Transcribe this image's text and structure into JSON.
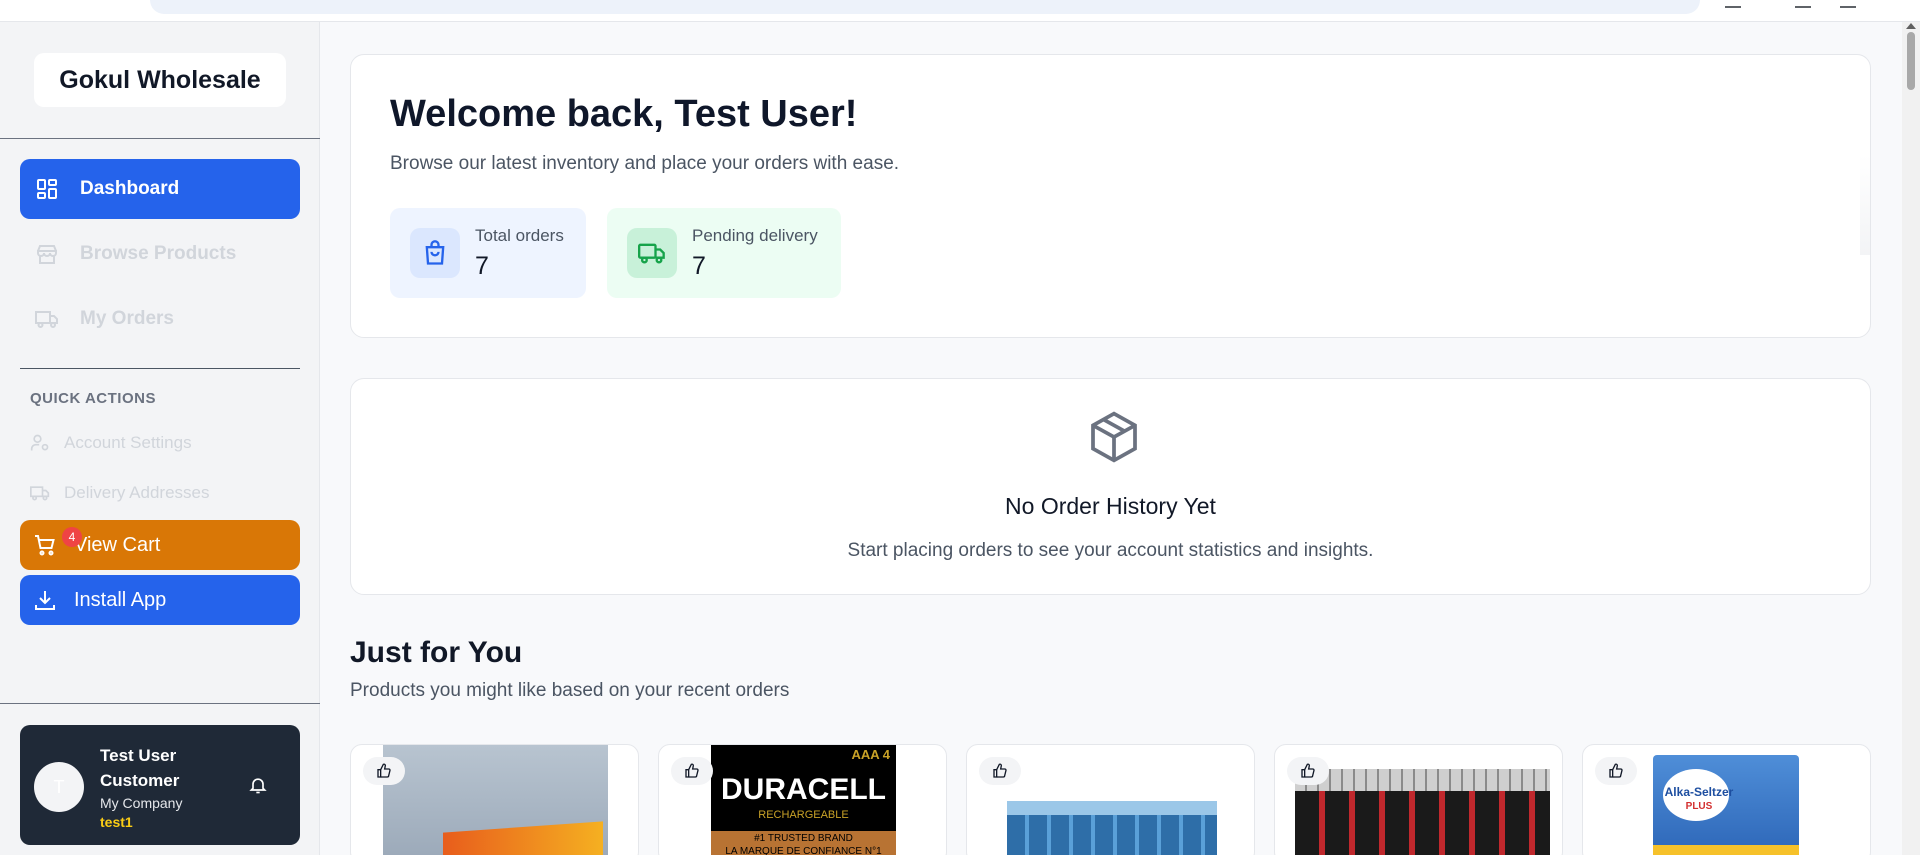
{
  "sidebar": {
    "brand": "Gokul Wholesale",
    "nav": [
      {
        "label": "Dashboard",
        "icon": "dashboard-icon",
        "active": true
      },
      {
        "label": "Browse Products",
        "icon": "store-icon",
        "active": false
      },
      {
        "label": "My Orders",
        "icon": "truck-icon",
        "active": false
      }
    ],
    "quick_actions_title": "QUICK ACTIONS",
    "quick_actions": [
      {
        "label": "Account Settings",
        "icon": "user-cog-icon"
      },
      {
        "label": "Delivery Addresses",
        "icon": "truck-icon"
      }
    ],
    "cart": {
      "label": "View Cart",
      "badge": "4",
      "icon": "cart-icon"
    },
    "install": {
      "label": "Install App",
      "icon": "download-icon"
    },
    "user": {
      "avatar_initial": "T",
      "name": "Test User Customer",
      "company": "My Company",
      "handle": "test1"
    }
  },
  "welcome": {
    "title": "Welcome back, Test User!",
    "subtitle": "Browse our latest inventory and place your orders with ease.",
    "stats": [
      {
        "label": "Total orders",
        "value": "7",
        "icon": "shopping-bag-icon"
      },
      {
        "label": "Pending delivery",
        "value": "7",
        "icon": "truck-icon"
      }
    ]
  },
  "empty_state": {
    "icon": "package-icon",
    "title": "No Order History Yet",
    "message": "Start placing orders to see your account statistics and insights."
  },
  "recommendations": {
    "title": "Just for You",
    "subtitle": "Products you might like based on your recent orders",
    "products": [
      {
        "image_text": "",
        "icon": "thumbs-up-icon"
      },
      {
        "image_text": "DURACELL",
        "image_subtext": "RECHARGEABLE",
        "image_corner": "AAA 4",
        "image_tagline": "#1 TRUSTED BRAND",
        "image_tagline2": "LA MARQUE DE CONFIANCE N°1",
        "icon": "thumbs-up-icon"
      },
      {
        "image_text": "",
        "icon": "thumbs-up-icon"
      },
      {
        "image_text": "",
        "icon": "thumbs-up-icon"
      },
      {
        "image_text": "Alka-Seltzer",
        "image_subtext": "PLUS",
        "icon": "thumbs-up-icon"
      }
    ]
  },
  "colors": {
    "primary": "#2563eb",
    "cart": "#d97706",
    "badge": "#ef4444",
    "user_card": "#1f2937",
    "handle": "#facc15"
  }
}
